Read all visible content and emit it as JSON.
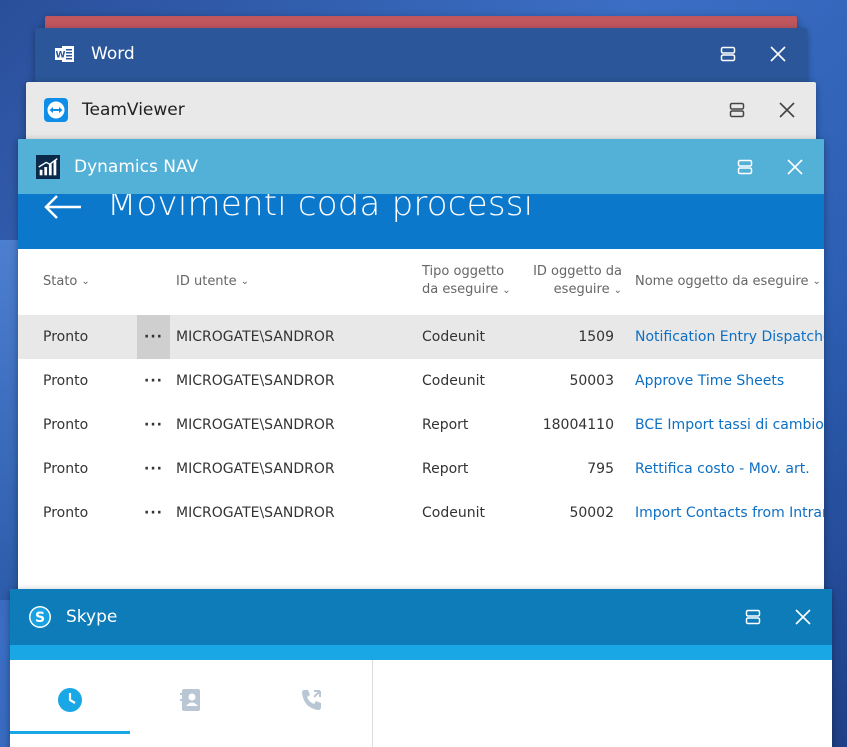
{
  "windows": {
    "word": {
      "title": "Word",
      "icon": "word-icon"
    },
    "teamviewer": {
      "title": "TeamViewer",
      "icon": "teamviewer-icon"
    },
    "dynamics": {
      "title": "Dynamics NAV",
      "icon": "dynamics-nav-icon"
    },
    "skype": {
      "title": "Skype",
      "icon": "skype-icon"
    }
  },
  "page": {
    "title": "Movimenti coda processi"
  },
  "table": {
    "headers": {
      "stato": "Stato",
      "id_utente": "ID utente",
      "tipo_line1": "Tipo oggetto",
      "tipo_line2": "da eseguire",
      "id_line1": "ID oggetto da",
      "id_line2": "eseguire",
      "nome": "Nome oggetto da eseguire"
    },
    "rows": [
      {
        "stato": "Pronto",
        "utente": "MICROGATE\\SANDROR",
        "tipo": "Codeunit",
        "id": "1509",
        "nome": "Notification Entry Dispatcher"
      },
      {
        "stato": "Pronto",
        "utente": "MICROGATE\\SANDROR",
        "tipo": "Codeunit",
        "id": "50003",
        "nome": "Approve Time Sheets"
      },
      {
        "stato": "Pronto",
        "utente": "MICROGATE\\SANDROR",
        "tipo": "Report",
        "id": "18004110",
        "nome": "BCE Import tassi di cambio"
      },
      {
        "stato": "Pronto",
        "utente": "MICROGATE\\SANDROR",
        "tipo": "Report",
        "id": "795",
        "nome": "Rettifica costo - Mov. art."
      },
      {
        "stato": "Pronto",
        "utente": "MICROGATE\\SANDROR",
        "tipo": "Codeunit",
        "id": "50002",
        "nome": "Import Contacts from Intrane"
      }
    ],
    "row_menu": "···"
  },
  "skype_tabs": [
    "recent-icon",
    "contacts-icon",
    "calls-icon"
  ],
  "colors": {
    "word": "#2b579a",
    "dynamics_title": "#53b0d6",
    "dynamics_header": "#0c78cc",
    "link": "#0d6fc4",
    "skype_title": "#0d7cb8",
    "skype_accent": "#19a7e6"
  }
}
